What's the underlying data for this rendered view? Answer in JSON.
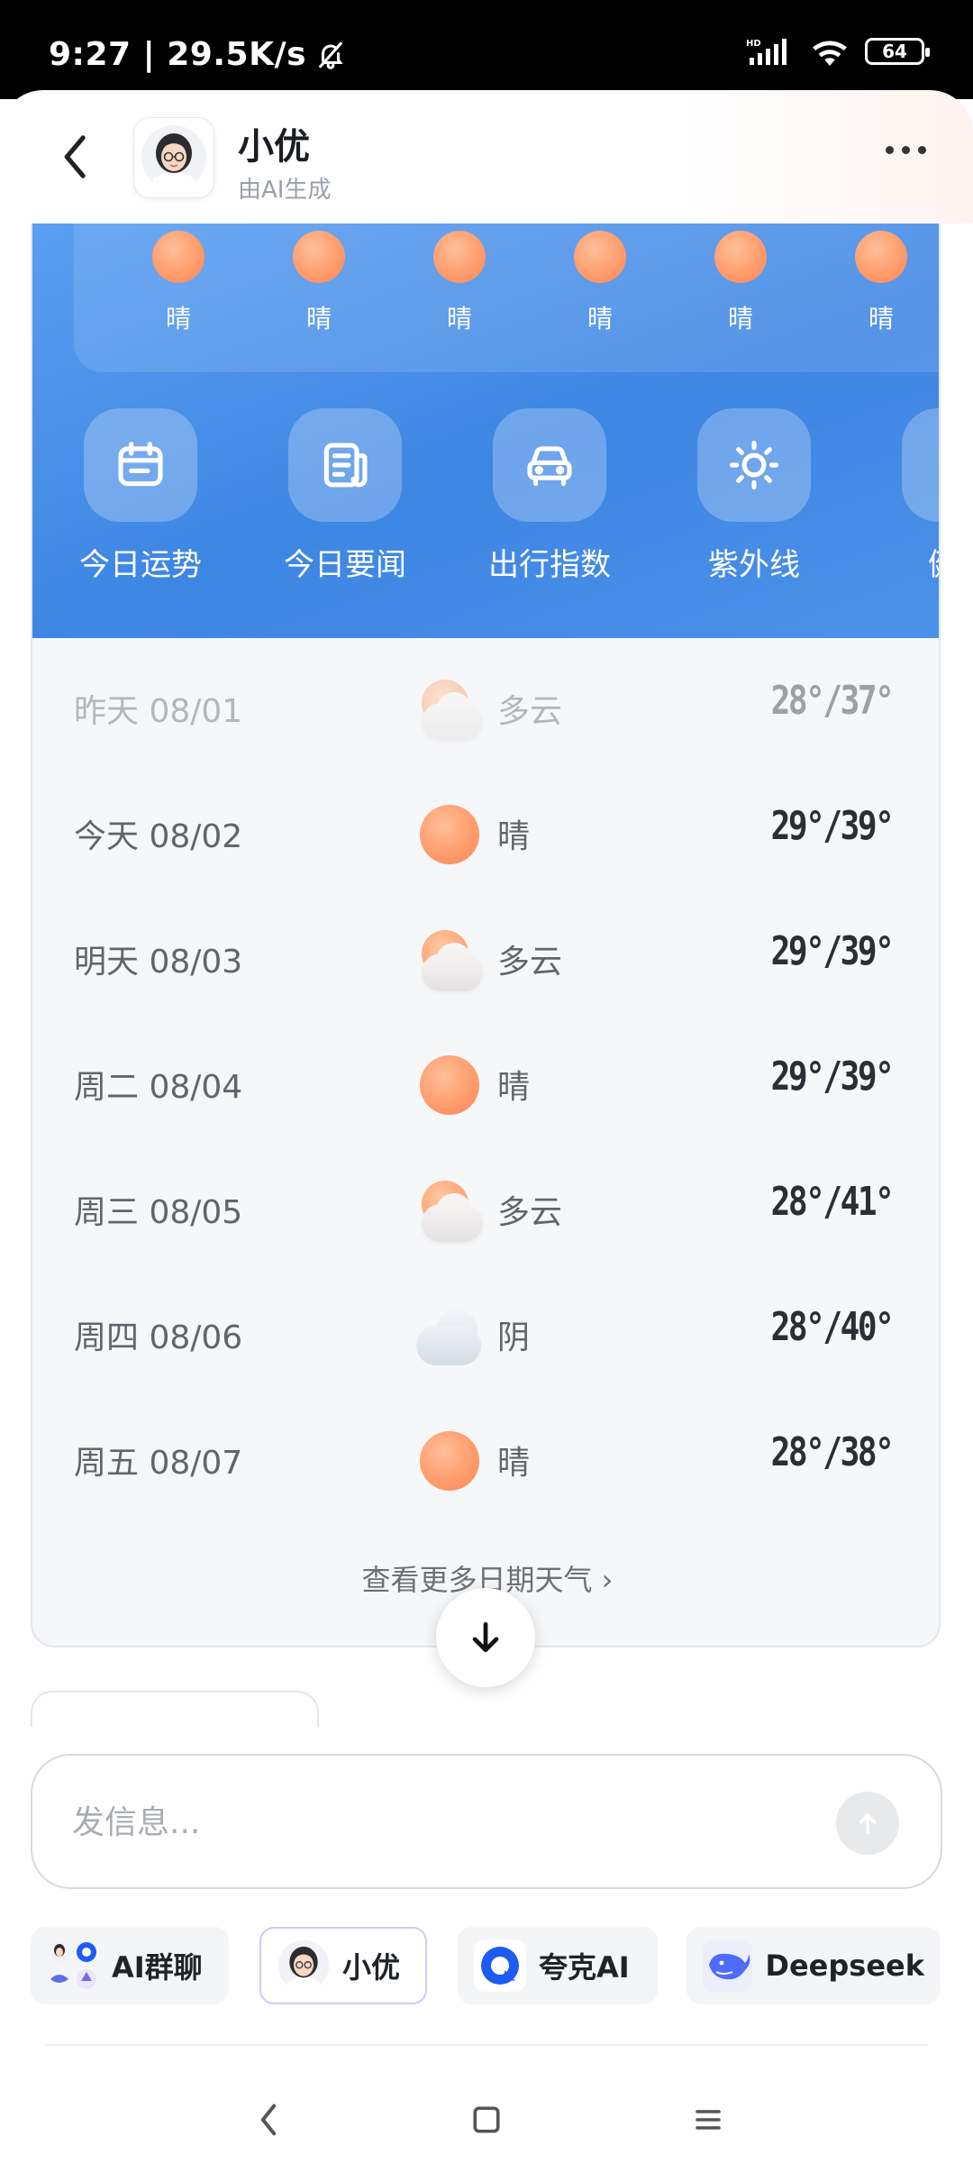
{
  "status_bar": {
    "time_speed": "9:27 | 29.5K/s",
    "network": "HD",
    "battery": "64"
  },
  "header": {
    "title": "小优",
    "subtitle": "由AI生成"
  },
  "hourly": [
    {
      "condition": "晴"
    },
    {
      "condition": "晴"
    },
    {
      "condition": "晴"
    },
    {
      "condition": "晴"
    },
    {
      "condition": "晴"
    },
    {
      "condition": "晴"
    }
  ],
  "services": [
    {
      "label": "今日运势",
      "icon": "calendar-icon"
    },
    {
      "label": "今日要闻",
      "icon": "news-icon"
    },
    {
      "label": "出行指数",
      "icon": "car-icon"
    },
    {
      "label": "紫外线",
      "icon": "sun-icon"
    },
    {
      "label": "健康",
      "icon": "health-icon"
    }
  ],
  "forecast": [
    {
      "date": "昨天 08/01",
      "condition": "多云",
      "icon": "cloud-sun-icon",
      "temp": "28°/37°"
    },
    {
      "date": "今天 08/02",
      "condition": "晴",
      "icon": "sun-icon",
      "temp": "29°/39°"
    },
    {
      "date": "明天 08/03",
      "condition": "多云",
      "icon": "cloud-sun-icon",
      "temp": "29°/39°"
    },
    {
      "date": "周二 08/04",
      "condition": "晴",
      "icon": "sun-icon",
      "temp": "29°/39°"
    },
    {
      "date": "周三 08/05",
      "condition": "多云",
      "icon": "cloud-sun-icon",
      "temp": "28°/41°"
    },
    {
      "date": "周四 08/06",
      "condition": "阴",
      "icon": "overcast-icon",
      "temp": "28°/40°"
    },
    {
      "date": "周五 08/07",
      "condition": "晴",
      "icon": "sun-icon",
      "temp": "28°/38°"
    }
  ],
  "more_link": "查看更多日期天气 ›",
  "input": {
    "placeholder": "发信息..."
  },
  "chips": [
    {
      "label": "AI群聊"
    },
    {
      "label": "小优"
    },
    {
      "label": "夸克AI"
    },
    {
      "label": "Deepseek"
    }
  ],
  "colors": {
    "accent_blue": "#3e86e4",
    "sun_orange": "#ff9a6a"
  }
}
